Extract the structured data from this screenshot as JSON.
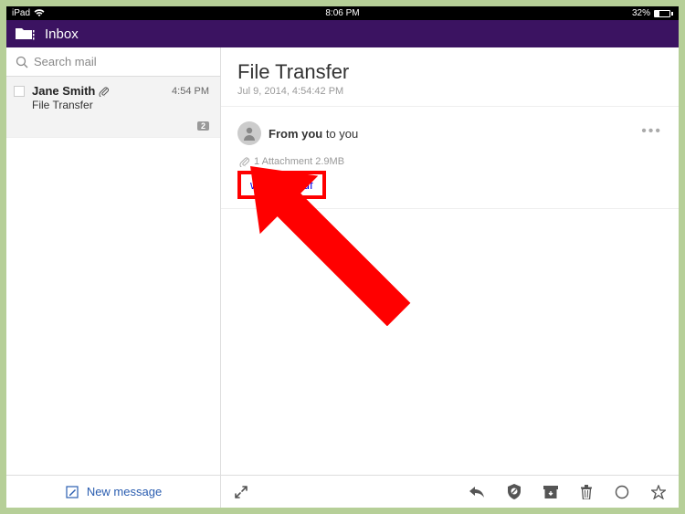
{
  "status": {
    "carrier": "iPad",
    "time": "8:06 PM",
    "battery_pct": "32%"
  },
  "header": {
    "title": "Inbox"
  },
  "search": {
    "placeholder": "Search mail"
  },
  "list": {
    "items": [
      {
        "name": "Jane Smith",
        "time": "4:54 PM",
        "subject": "File Transfer",
        "badge": "2"
      }
    ]
  },
  "compose": {
    "label": "New message"
  },
  "mail": {
    "subject": "File Transfer",
    "date": "Jul 9, 2014, 4:54:42 PM",
    "from_bold": "From you",
    "from_rest": " to you",
    "attach_summary": "1 Attachment  2.9MB",
    "attach_name": "wikiHow.pdf"
  }
}
